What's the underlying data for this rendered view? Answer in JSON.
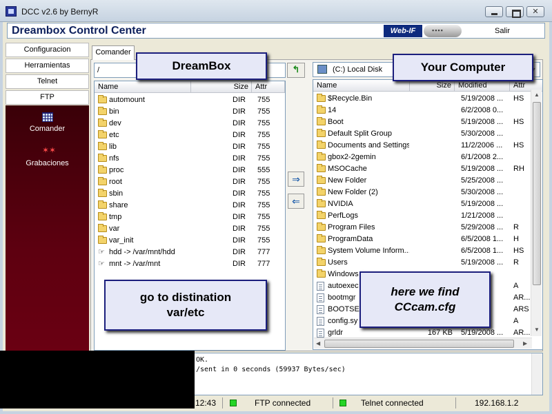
{
  "window": {
    "title": "DCC v2.6 by BernyR"
  },
  "header": {
    "title": "Dreambox Control Center",
    "webif_label": "Web-IF",
    "exit_label": "Salir"
  },
  "menu": [
    "Configuracion",
    "Herramientas",
    "Telnet",
    "FTP"
  ],
  "nav": [
    {
      "label": "Comander",
      "icon": "table-icon"
    },
    {
      "label": "Grabaciones",
      "icon": "record-icon"
    }
  ],
  "tab": {
    "label": "Comander"
  },
  "left": {
    "path": "/",
    "columns": {
      "name": "Name",
      "size": "Size",
      "attr": "Attr"
    },
    "rows": [
      {
        "name": "automount",
        "size": "DIR",
        "attr": "755",
        "icon": "folder"
      },
      {
        "name": "bin",
        "size": "DIR",
        "attr": "755",
        "icon": "folder"
      },
      {
        "name": "dev",
        "size": "DIR",
        "attr": "755",
        "icon": "folder"
      },
      {
        "name": "etc",
        "size": "DIR",
        "attr": "755",
        "icon": "folder"
      },
      {
        "name": "lib",
        "size": "DIR",
        "attr": "755",
        "icon": "folder"
      },
      {
        "name": "nfs",
        "size": "DIR",
        "attr": "755",
        "icon": "folder"
      },
      {
        "name": "proc",
        "size": "DIR",
        "attr": "555",
        "icon": "folder"
      },
      {
        "name": "root",
        "size": "DIR",
        "attr": "755",
        "icon": "folder"
      },
      {
        "name": "sbin",
        "size": "DIR",
        "attr": "755",
        "icon": "folder"
      },
      {
        "name": "share",
        "size": "DIR",
        "attr": "755",
        "icon": "folder"
      },
      {
        "name": "tmp",
        "size": "DIR",
        "attr": "755",
        "icon": "folder"
      },
      {
        "name": "var",
        "size": "DIR",
        "attr": "755",
        "icon": "folder"
      },
      {
        "name": "var_init",
        "size": "DIR",
        "attr": "755",
        "icon": "folder"
      },
      {
        "name": "hdd -> /var/mnt/hdd",
        "size": "DIR",
        "attr": "777",
        "icon": "link"
      },
      {
        "name": "mnt -> /var/mnt",
        "size": "DIR",
        "attr": "777",
        "icon": "link"
      }
    ]
  },
  "right": {
    "drive": "(C:)  Local Disk",
    "columns": {
      "name": "Name",
      "size": "Size",
      "modified": "Modified",
      "attr": "Attr"
    },
    "rows": [
      {
        "name": "$Recycle.Bin",
        "size": "",
        "modified": "5/19/2008 ...",
        "attr": "HS",
        "icon": "folder"
      },
      {
        "name": "14",
        "size": "",
        "modified": "6/2/2008 0...",
        "attr": "",
        "icon": "folder"
      },
      {
        "name": "Boot",
        "size": "",
        "modified": "5/19/2008 ...",
        "attr": "HS",
        "icon": "folder"
      },
      {
        "name": "Default Split Group",
        "size": "",
        "modified": "5/30/2008 ...",
        "attr": "",
        "icon": "folder"
      },
      {
        "name": "Documents and Settings",
        "size": "",
        "modified": "11/2/2006 ...",
        "attr": "HS",
        "icon": "folder"
      },
      {
        "name": "gbox2-2gemin",
        "size": "",
        "modified": "6/1/2008 2...",
        "attr": "",
        "icon": "folder"
      },
      {
        "name": "MSOCache",
        "size": "",
        "modified": "5/19/2008 ...",
        "attr": "RH",
        "icon": "folder"
      },
      {
        "name": "New Folder",
        "size": "",
        "modified": "5/25/2008 ...",
        "attr": "",
        "icon": "folder"
      },
      {
        "name": "New Folder (2)",
        "size": "",
        "modified": "5/30/2008 ...",
        "attr": "",
        "icon": "folder"
      },
      {
        "name": "NVIDIA",
        "size": "",
        "modified": "5/19/2008 ...",
        "attr": "",
        "icon": "folder"
      },
      {
        "name": "PerfLogs",
        "size": "",
        "modified": "1/21/2008 ...",
        "attr": "",
        "icon": "folder"
      },
      {
        "name": "Program Files",
        "size": "",
        "modified": "5/29/2008 ...",
        "attr": "R",
        "icon": "folder"
      },
      {
        "name": "ProgramData",
        "size": "",
        "modified": "6/5/2008 1...",
        "attr": "H",
        "icon": "folder"
      },
      {
        "name": "System Volume Inform...",
        "size": "",
        "modified": "6/5/2008 1...",
        "attr": "HS",
        "icon": "folder"
      },
      {
        "name": "Users",
        "size": "",
        "modified": "5/19/2008 ...",
        "attr": "R",
        "icon": "folder"
      },
      {
        "name": "Windows",
        "size": "",
        "modified": "",
        "attr": "",
        "icon": "folder"
      },
      {
        "name": "autoexec",
        "size": "",
        "modified": "",
        "attr": "A",
        "icon": "file"
      },
      {
        "name": "bootmgr",
        "size": "",
        "modified": "",
        "attr": "AR...",
        "icon": "file"
      },
      {
        "name": "BOOTSEC",
        "size": "",
        "modified": "",
        "attr": "ARS",
        "icon": "file"
      },
      {
        "name": "config.sy",
        "size": "",
        "modified": "",
        "attr": "A",
        "icon": "file"
      },
      {
        "name": "grldr",
        "size": "167 KB",
        "modified": "5/19/2008 ...",
        "attr": "AR...",
        "icon": "file"
      }
    ]
  },
  "callouts": {
    "dreambox": "DreamBox",
    "computer": "Your Computer",
    "goto": "go to distination\nvar/etc",
    "find": "here we find\nCCcam.cfg"
  },
  "log": [
    "OK.",
    "/sent in 0 seconds (59937 Bytes/sec)"
  ],
  "status": {
    "time": "12:43",
    "ftp": "FTP connected",
    "telnet": "Telnet connected",
    "ip": "192.168.1.2"
  },
  "colors": {
    "nav_bg": "#5e0010",
    "callout_border": "#1b1e7d",
    "title_text": "#0c1f5c",
    "led": "#25d425"
  }
}
